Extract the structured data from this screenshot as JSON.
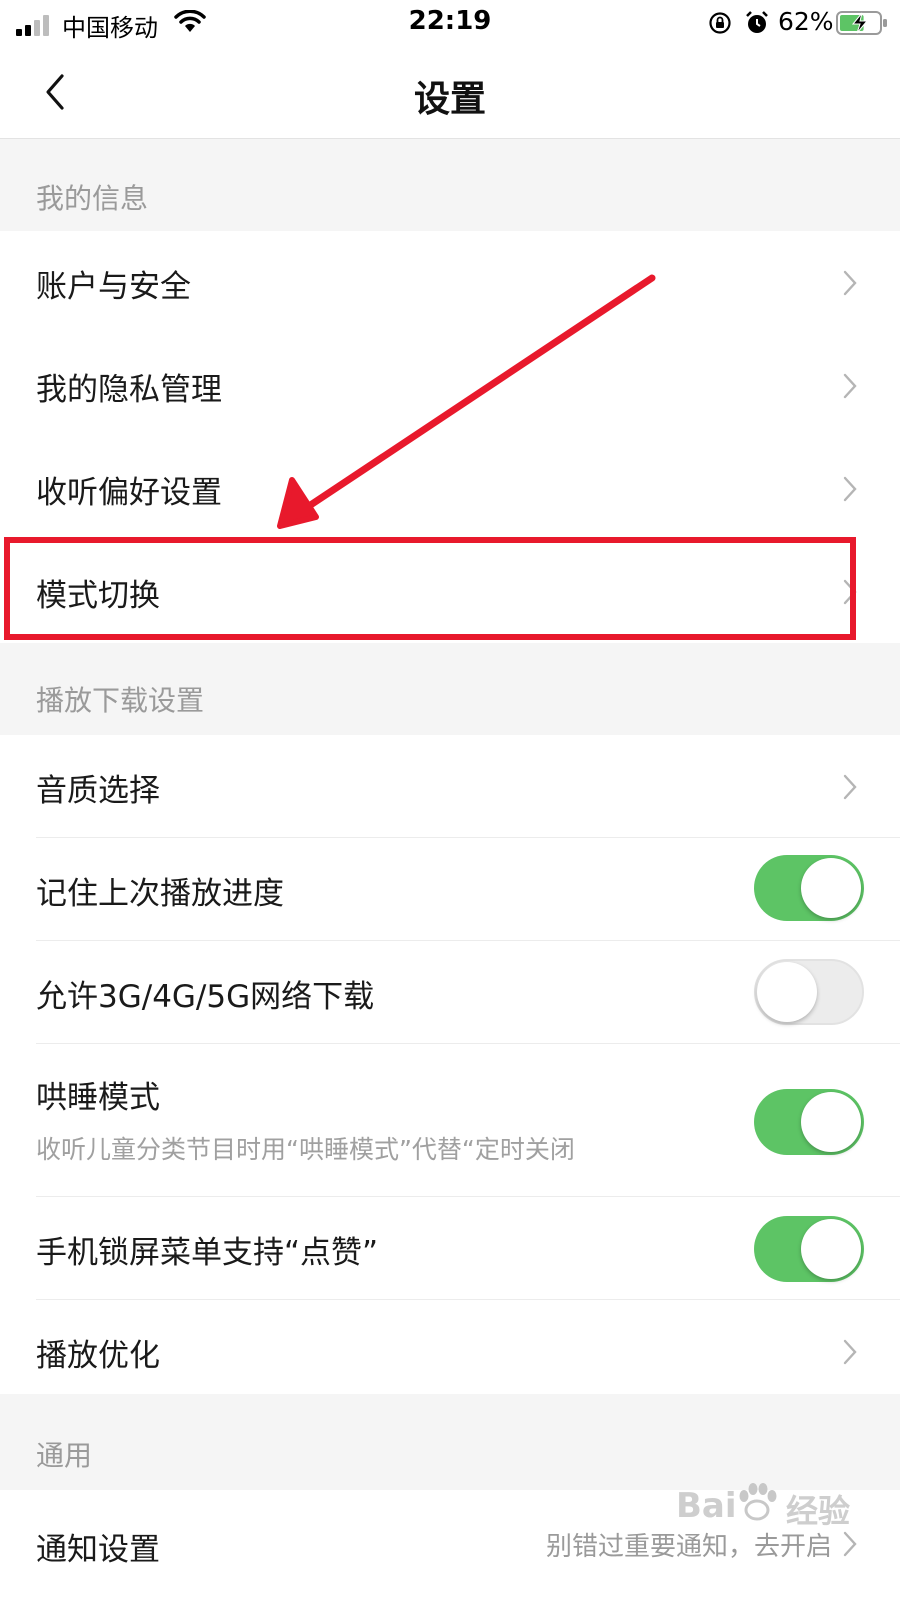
{
  "status_bar": {
    "carrier": "中国移动",
    "time": "22:19",
    "battery_percent": "62%",
    "battery_level": 0.62,
    "icons": [
      "signal-icon",
      "wifi-icon",
      "rotation-lock-icon",
      "alarm-icon",
      "battery-charging-icon"
    ]
  },
  "nav": {
    "title": "设置",
    "back_icon": "chevron-left-icon"
  },
  "sections": {
    "my_info": {
      "header": "我的信息",
      "items": [
        {
          "label": "账户与安全"
        },
        {
          "label": "我的隐私管理"
        },
        {
          "label": "收听偏好设置"
        },
        {
          "label": "模式切换"
        }
      ]
    },
    "playback": {
      "header": "播放下载设置",
      "items": [
        {
          "label": "音质选择"
        },
        {
          "label": "记住上次播放进度",
          "toggle": true
        },
        {
          "label": "允许3G/4G/5G网络下载",
          "toggle": false
        },
        {
          "label": "哄睡模式",
          "subtitle": "收听儿童分类节目时用“哄睡模式”代替“定时关闭",
          "toggle": true
        },
        {
          "label": "手机锁屏菜单支持“点赞”",
          "toggle": true
        },
        {
          "label": "播放优化"
        }
      ]
    },
    "general": {
      "header": "通用",
      "items": [
        {
          "label": "通知设置",
          "value": "别错过重要通知，去开启"
        }
      ]
    }
  },
  "annotation": {
    "highlight_color": "#e8192c"
  },
  "colors": {
    "toggle_on": "#5dc465",
    "toggle_off": "#ececec",
    "section_bg": "#f5f5f5"
  },
  "watermark": {
    "text_left": "Bai",
    "text_right": "经验"
  }
}
